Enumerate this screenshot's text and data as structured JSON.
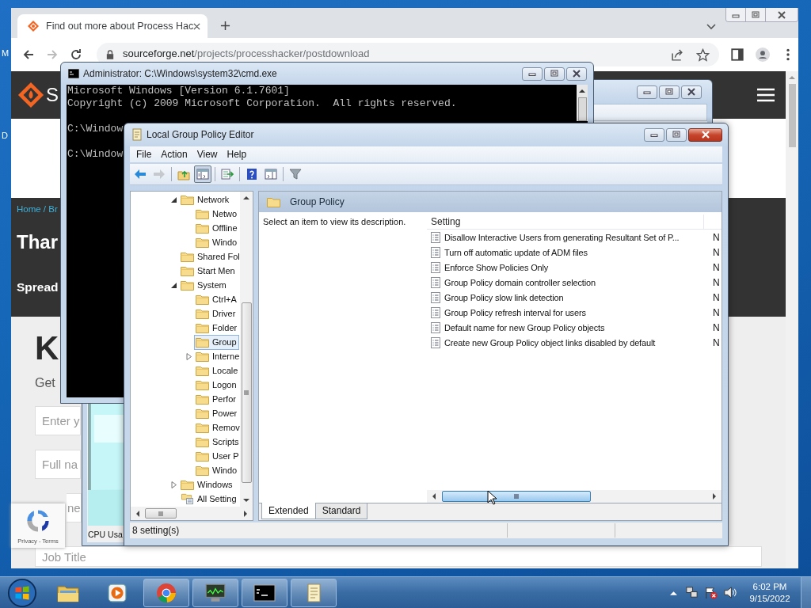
{
  "desktop": {
    "icon_labels": [
      "M",
      "D"
    ]
  },
  "browser": {
    "tab": {
      "title": "Find out more about Process Hac"
    },
    "address": {
      "host": "sourceforge.net",
      "path": "/projects/processhacker/postdownload"
    },
    "page": {
      "logo_text": "S",
      "breadcrumb": "Home / Br",
      "heading": "Thar",
      "subheading": "Spread",
      "big_letter": "K",
      "intro": "Get",
      "form_fields": [
        {
          "placeholder": "Enter y",
          "cut_left": false
        },
        {
          "placeholder": "Full na",
          "cut_left": false
        },
        {
          "placeholder": "ne",
          "cut_left": true
        },
        {
          "placeholder": "Job Title",
          "cut_left": false
        }
      ]
    }
  },
  "recaptcha": {
    "links": "Privacy - Terms"
  },
  "process_window": {
    "graph_label": "CPU Usa"
  },
  "cmd": {
    "title": "Administrator: C:\\Windows\\system32\\cmd.exe",
    "paragraphs": [
      [
        "Microsoft Windows [Version 6.1.7601]",
        "Copyright (c) 2009 Microsoft Corporation.  All rights reserved."
      ],
      [
        "C:\\Window"
      ],
      [
        "C:\\Window"
      ]
    ]
  },
  "gpe": {
    "title": "Local Group Policy Editor",
    "menu": [
      "File",
      "Action",
      "View",
      "Help"
    ],
    "toolbar": [
      [
        {
          "kind": "back",
          "disabled": false,
          "pressed": false
        },
        {
          "kind": "forward",
          "disabled": true,
          "pressed": false
        }
      ],
      [
        {
          "kind": "up",
          "disabled": false,
          "pressed": false
        },
        {
          "kind": "console_tree",
          "disabled": false,
          "pressed": true
        }
      ],
      [
        {
          "kind": "export",
          "disabled": false,
          "pressed": false
        }
      ],
      [
        {
          "kind": "help",
          "disabled": false,
          "pressed": false
        },
        {
          "kind": "action_pane",
          "disabled": false,
          "pressed": false
        }
      ],
      [
        {
          "kind": "filter",
          "disabled": false,
          "pressed": false
        }
      ]
    ],
    "tree": [
      {
        "label": "Network",
        "kind": "folder",
        "expanded": true,
        "selected": false,
        "children": [
          {
            "label": "Netwo",
            "kind": "folder",
            "selected": false
          },
          {
            "label": "Offline",
            "kind": "folder",
            "selected": false
          },
          {
            "label": "Windo",
            "kind": "folder",
            "selected": false
          }
        ]
      },
      {
        "label": "Shared Fol",
        "kind": "folder",
        "selected": false
      },
      {
        "label": "Start Men",
        "kind": "folder",
        "selected": false
      },
      {
        "label": "System",
        "kind": "folder",
        "expanded": true,
        "selected": false,
        "children": [
          {
            "label": "Ctrl+A",
            "kind": "folder",
            "selected": false
          },
          {
            "label": "Driver",
            "kind": "folder",
            "selected": false
          },
          {
            "label": "Folder",
            "kind": "folder",
            "selected": false
          },
          {
            "label": "Group",
            "kind": "folder",
            "selected": true
          },
          {
            "label": "Interne",
            "kind": "folder",
            "expanded": false,
            "selected": false
          },
          {
            "label": "Locale",
            "kind": "folder",
            "selected": false
          },
          {
            "label": "Logon",
            "kind": "folder",
            "selected": false
          },
          {
            "label": "Perfor",
            "kind": "folder",
            "selected": false
          },
          {
            "label": "Power",
            "kind": "folder",
            "selected": false
          },
          {
            "label": "Remov",
            "kind": "folder",
            "selected": false
          },
          {
            "label": "Scripts",
            "kind": "folder",
            "selected": false
          },
          {
            "label": "User P",
            "kind": "folder",
            "selected": false
          },
          {
            "label": "Windo",
            "kind": "folder",
            "selected": false
          }
        ]
      },
      {
        "label": "Windows",
        "kind": "folder",
        "expanded": false,
        "selected": false
      },
      {
        "label": "All Setting",
        "kind": "settings",
        "selected": false
      }
    ],
    "header": "Group Policy",
    "description": "Select an item to view its description.",
    "columns": [
      "Setting"
    ],
    "rows": [
      {
        "setting": "Disallow Interactive Users from generating Resultant Set of P...",
        "column_2": "N"
      },
      {
        "setting": "Turn off automatic update of ADM files",
        "column_2": "N"
      },
      {
        "setting": "Enforce Show Policies Only",
        "column_2": "N"
      },
      {
        "setting": "Group Policy domain controller selection",
        "column_2": "N"
      },
      {
        "setting": "Group Policy slow link detection",
        "column_2": "N"
      },
      {
        "setting": "Group Policy refresh interval for users",
        "column_2": "N"
      },
      {
        "setting": "Default name for new Group Policy objects",
        "column_2": "N"
      },
      {
        "setting": "Create new Group Policy object links disabled by default",
        "column_2": "N"
      }
    ],
    "tabs": [
      {
        "label": "Extended",
        "selected": true
      },
      {
        "label": "Standard",
        "selected": false
      }
    ],
    "status": "8 setting(s)"
  },
  "taskbar": {
    "apps": [
      {
        "kind": "explorer",
        "running": false
      },
      {
        "kind": "media_player",
        "running": false
      },
      {
        "kind": "chrome",
        "running": true
      },
      {
        "kind": "process_hacker",
        "running": true
      },
      {
        "kind": "cmd",
        "running": true
      },
      {
        "kind": "gpedit",
        "running": true
      }
    ],
    "clock": {
      "time": "6:02 PM",
      "date": "9/15/2022"
    }
  }
}
